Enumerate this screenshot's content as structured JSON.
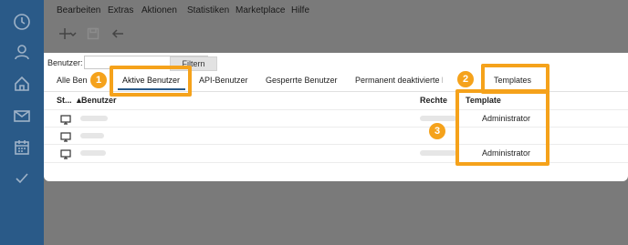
{
  "menu": [
    "Bearbeiten",
    "Extras",
    "Aktionen",
    "Statistiken",
    "Marketplace",
    "Hilfe"
  ],
  "sidebar_icons": [
    "clock-icon",
    "user-icon",
    "home-icon",
    "mail-icon",
    "calendar-icon",
    "checkmark-icon"
  ],
  "filter": {
    "label": "Benutzer:",
    "value": "",
    "button": "Filtern"
  },
  "tabs": [
    "Alle Benutzer",
    "Aktive Benutzer",
    "API-Benutzer",
    "Gesperrte Benutzer",
    "Permanent deaktivierte Benutzer",
    "Templates"
  ],
  "active_tab": "Aktive Benutzer",
  "table": {
    "headers": {
      "status": "St...",
      "user": "Benutzer",
      "rights": "Rechte",
      "template": "Template"
    },
    "rows": [
      {
        "template": "Administrator"
      },
      {
        "template": ""
      },
      {
        "template": "Administrator"
      }
    ]
  },
  "callouts": [
    "1",
    "2",
    "3"
  ],
  "colors": {
    "accent": "#f5a21b",
    "sidebar": "#2a5a88",
    "overlay": "#7a7a7a"
  }
}
